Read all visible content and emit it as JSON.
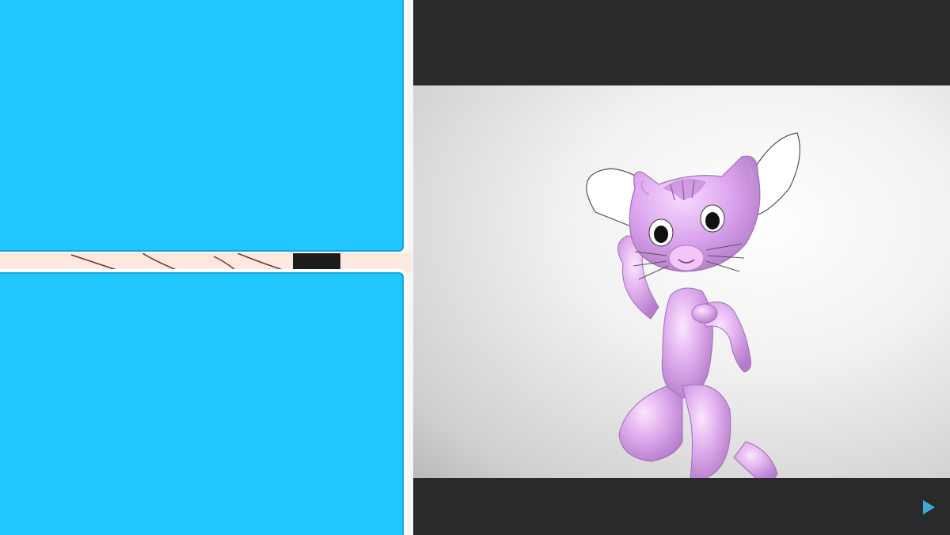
{
  "captions": {
    "top_text": "",
    "bottom_text": ""
  },
  "colors": {
    "panel_blue": "#20c6fd",
    "caption_green": "#1e7c35",
    "caption_outline": "#fff8a8",
    "letterbox": "#2a2a2c",
    "cat_pink": "#e6b3f0",
    "play_icon": "#3fa9d8"
  },
  "icons": {
    "play": "play-icon"
  }
}
